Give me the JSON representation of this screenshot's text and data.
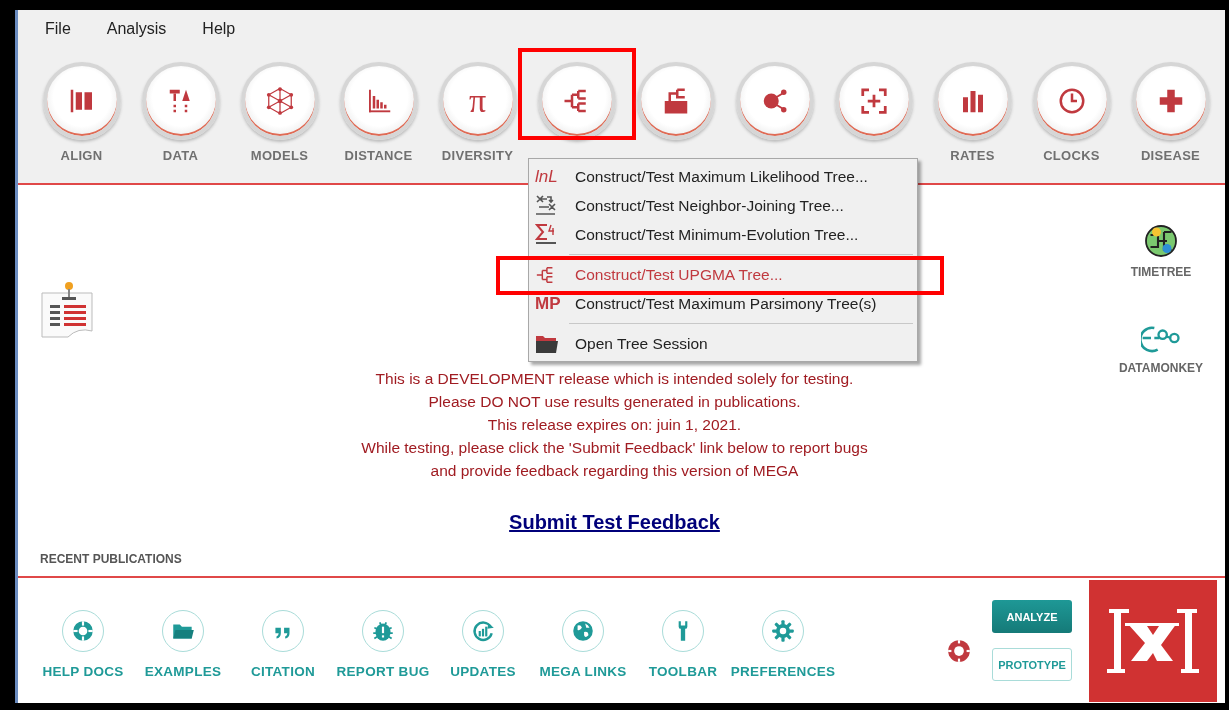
{
  "menu_bar": [
    {
      "label": "File"
    },
    {
      "label": "Analysis"
    },
    {
      "label": "Help"
    }
  ],
  "toolbar": [
    {
      "label": "ALIGN",
      "highlighted": false
    },
    {
      "label": "DATA",
      "highlighted": false
    },
    {
      "label": "MODELS",
      "highlighted": false
    },
    {
      "label": "DISTANCE",
      "highlighted": false
    },
    {
      "glyph": "π",
      "label": "DIVERSITY",
      "highlighted": false
    },
    {
      "highlighted": true
    },
    {
      "highlighted": false
    },
    {
      "highlighted": false
    },
    {
      "highlighted": false
    },
    {
      "label": "RATES",
      "highlighted": false
    },
    {
      "label": "CLOCKS",
      "highlighted": false
    },
    {
      "label": "DISEASE",
      "highlighted": false
    }
  ],
  "dropdown": [
    {
      "kind": "item",
      "badge": "lnL",
      "label": "Construct/Test Maximum Likelihood Tree...",
      "selected": false,
      "highlighted": false
    },
    {
      "kind": "item",
      "label": "Construct/Test Neighbor-Joining Tree...",
      "selected": false,
      "highlighted": false
    },
    {
      "kind": "item",
      "label": "Construct/Test Minimum-Evolution Tree...",
      "selected": false,
      "highlighted": false
    },
    {
      "kind": "separator"
    },
    {
      "kind": "item",
      "label": "Construct/Test UPGMA Tree...",
      "selected": true,
      "highlighted": true
    },
    {
      "kind": "item",
      "badge": "MP",
      "label": "Construct/Test Maximum Parsimony Tree(s)",
      "selected": false,
      "highlighted": false
    },
    {
      "kind": "separator"
    },
    {
      "kind": "item",
      "label": "Open Tree Session",
      "selected": false,
      "highlighted": false
    }
  ],
  "side_links": [
    {
      "label": "TIMETREE"
    },
    {
      "label": "DATAMONKEY"
    }
  ],
  "notice": [
    "This is a DEVELOPMENT release which is intended solely for testing.",
    "Please DO NOT use results generated in publications.",
    "This release expires on: juin 1, 2021.",
    "While testing, please click the 'Submit Feedback' link below to report bugs",
    "and provide feedback regarding this version of MEGA"
  ],
  "feedback_link": "Submit Test Feedback",
  "recent_publications": "RECENT PUBLICATIONS",
  "footer_links": [
    {
      "label": "HELP DOCS"
    },
    {
      "label": "EXAMPLES"
    },
    {
      "label": "CITATION"
    },
    {
      "label": "REPORT BUG"
    },
    {
      "label": "UPDATES"
    },
    {
      "label": "MEGA LINKS"
    },
    {
      "label": "TOOLBAR"
    },
    {
      "label": "PREFERENCES"
    }
  ],
  "mode_buttons": [
    {
      "label": "ANALYZE",
      "selected": true
    },
    {
      "label": "PROTOTYPE",
      "selected": false
    }
  ]
}
